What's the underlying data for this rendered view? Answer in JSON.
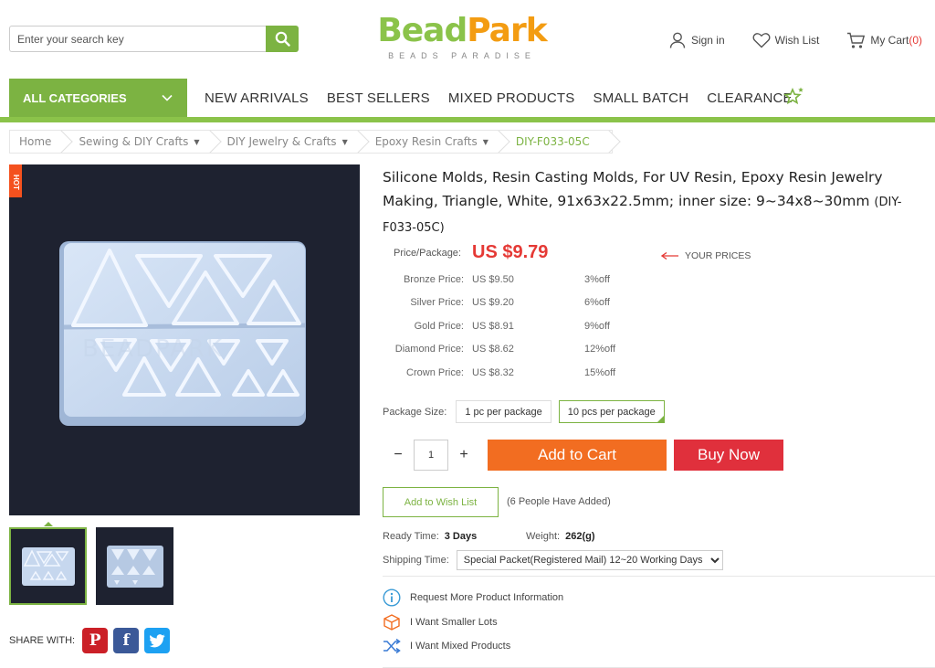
{
  "colors": {
    "brand_green": "#7cb342",
    "accent_orange": "#f26d21",
    "price_red": "#e53935",
    "buy_red": "#e0303c"
  },
  "header": {
    "search": {
      "placeholder": "Enter your search key",
      "icon": "search-icon"
    },
    "logo": {
      "part1": "Bead",
      "part2": "Park",
      "tagline": "BEADS PARADISE"
    },
    "links": {
      "sign_in": "Sign in",
      "wish_list": "Wish List",
      "cart": "My Cart",
      "cart_count": "(0)"
    }
  },
  "nav": {
    "all_categories": "ALL CATEGORIES",
    "items": [
      "NEW ARRIVALS",
      "BEST SELLERS",
      "MIXED PRODUCTS",
      "SMALL BATCH",
      "CLEARANCE"
    ]
  },
  "breadcrumb": [
    "Home",
    "Sewing & DIY Crafts",
    "DIY Jewelry & Crafts",
    "Epoxy Resin Crafts",
    "DIY-F033-05C"
  ],
  "product": {
    "badge": "HOT",
    "watermark": "BEADPARK",
    "title": "Silicone Molds, Resin Casting Molds, For UV Resin, Epoxy Resin Jewelry Making, Triangle, White, 91x63x22.5mm; inner size: 9~34x8~30mm",
    "sku": "(DIY-F033-05C)",
    "price_label": "Price/Package:",
    "price": "US $9.79",
    "your_prices": "YOUR PRICES",
    "tiers": [
      {
        "label": "Bronze Price:",
        "value": "US $9.50",
        "off": "3%off"
      },
      {
        "label": "Silver Price:",
        "value": "US $9.20",
        "off": "6%off"
      },
      {
        "label": "Gold Price:",
        "value": "US $8.91",
        "off": "9%off"
      },
      {
        "label": "Diamond Price:",
        "value": "US $8.62",
        "off": "12%off"
      },
      {
        "label": "Crown Price:",
        "value": "US $8.32",
        "off": "15%off"
      }
    ],
    "package_size_label": "Package Size:",
    "package_options": [
      "1 pc per package",
      "10 pcs per package"
    ],
    "selected_package": "10 pcs per package",
    "quantity": "1",
    "add_to_cart": "Add to Cart",
    "buy_now": "Buy Now",
    "add_to_wish": "Add to Wish List",
    "wish_added": "(6 People Have Added)",
    "ready_time_label": "Ready Time:",
    "ready_time": "3 Days",
    "weight_label": "Weight:",
    "weight": "262(g)",
    "shipping_label": "Shipping Time:",
    "shipping_value": "Special Packet(Registered Mail) 12~20 Working Days",
    "links": [
      "Request More Product Information",
      "I Want Smaller Lots",
      "I Want Mixed Products"
    ]
  },
  "share": {
    "label": "SHARE WITH:",
    "networks": [
      "pinterest-icon",
      "facebook-icon",
      "twitter-icon"
    ]
  }
}
